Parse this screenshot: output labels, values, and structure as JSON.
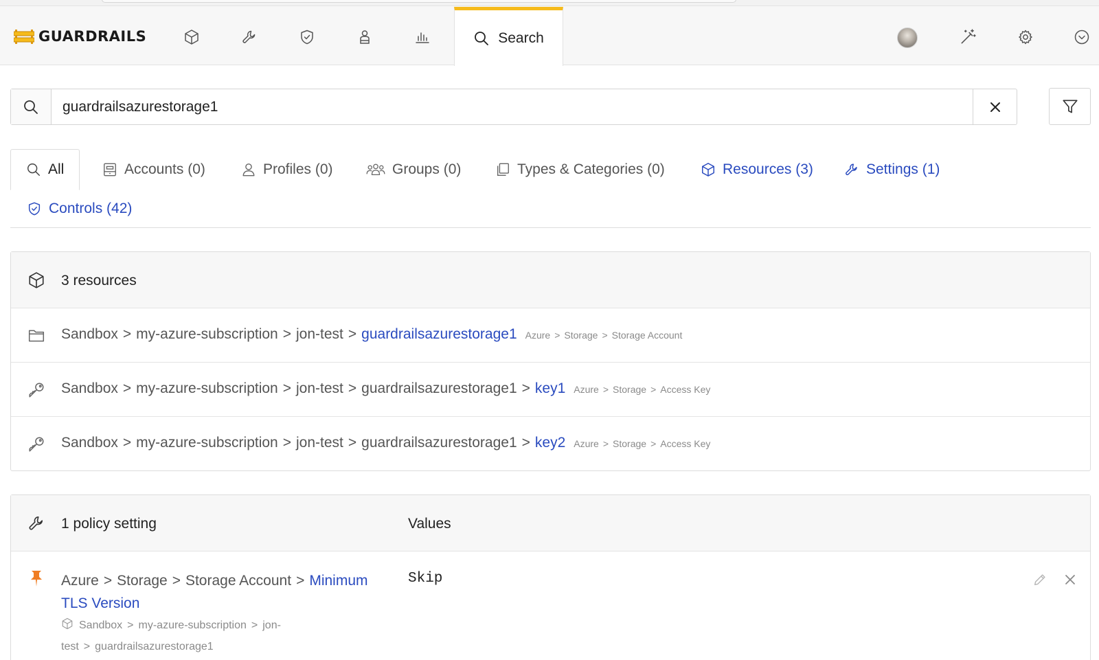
{
  "app": {
    "brand": "GUARDRAILS",
    "active_tab_label": "Search",
    "nav_icons": [
      "cube-icon",
      "wrench-icon",
      "shield-check-icon",
      "user-badge-icon",
      "bar-chart-icon"
    ],
    "right_icons": [
      "avatar",
      "magic-wand-icon",
      "gear-icon",
      "chevron-down-circle-icon"
    ],
    "accent_color": "#f6bb1b",
    "link_color": "#2a4bbf"
  },
  "search": {
    "value": "guardrailsazurestorage1"
  },
  "tabs": [
    {
      "label": "All",
      "icon": "search-icon",
      "active": true
    },
    {
      "label": "Accounts (0)",
      "icon": "account-icon"
    },
    {
      "label": "Profiles (0)",
      "icon": "profile-icon"
    },
    {
      "label": "Groups (0)",
      "icon": "groups-icon"
    },
    {
      "label": "Types & Categories (0)",
      "icon": "types-icon"
    },
    {
      "label": "Resources (3)",
      "icon": "cube-icon"
    },
    {
      "label": "Settings (1)",
      "icon": "wrench-icon"
    },
    {
      "label": "Controls (42)",
      "icon": "shield-check-icon"
    }
  ],
  "resources": {
    "header": "3 resources",
    "separator": ">",
    "rows": [
      {
        "icon": "folder-icon",
        "crumbs": [
          "Sandbox",
          "my-azure-subscription",
          "jon-test"
        ],
        "name": "guardrailsazurestorage1",
        "type": [
          "Azure",
          "Storage",
          "Storage Account"
        ]
      },
      {
        "icon": "key-icon",
        "crumbs": [
          "Sandbox",
          "my-azure-subscription",
          "jon-test",
          "guardrailsazurestorage1"
        ],
        "name": "key1",
        "type": [
          "Azure",
          "Storage",
          "Access Key"
        ]
      },
      {
        "icon": "key-icon",
        "crumbs": [
          "Sandbox",
          "my-azure-subscription",
          "jon-test",
          "guardrailsazurestorage1"
        ],
        "name": "key2",
        "type": [
          "Azure",
          "Storage",
          "Access Key"
        ]
      }
    ]
  },
  "policy": {
    "header": "1 policy setting",
    "values_header": "Values",
    "setting": {
      "crumbs": [
        "Azure",
        "Storage",
        "Storage Account"
      ],
      "name": "Minimum TLS Version",
      "resource_crumbs": [
        "Sandbox",
        "my-azure-subscription",
        "jon-test"
      ],
      "resource_name": "guardrailsazurestorage1",
      "value": "Skip",
      "pin_color": "#f07d22"
    }
  }
}
